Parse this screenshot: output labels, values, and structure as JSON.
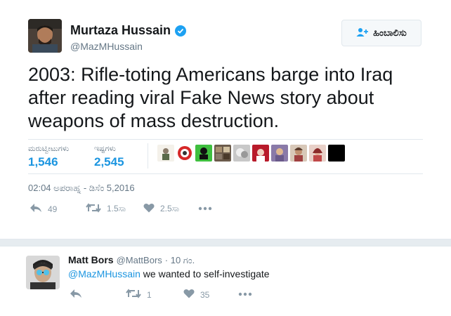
{
  "tweet": {
    "author": {
      "name": "Murtaza Hussain",
      "handle": "@MazMHussain"
    },
    "follow_label": "ಹಿಂಬಾಲಿಸು",
    "text": "2003: Rifle-toting Americans barge into Iraq after reading viral Fake News story about weapons of mass destruction.",
    "stats": {
      "retweets_label": "ಮರುಟ್ವೀಟುಗಳು",
      "retweets_value": "1,546",
      "likes_label": "ಇಷ್ಟಗಳು",
      "likes_value": "2,545"
    },
    "timestamp": "02:04 ಅಪರಾಹ್ನ - ಡಿಸೆಂ 5,2016",
    "actions": {
      "reply_count": "49",
      "retweet_count": "1.5ಸಾ",
      "like_count": "2.5ಸಾ"
    }
  },
  "reply": {
    "name": "Matt Bors",
    "handle": "@MattBors",
    "time": "· 10 ಗಂ.",
    "mention": "@MazMHussain",
    "text": " we wanted to self-investigate",
    "retweet_count": "1",
    "like_count": "35"
  },
  "colors": {
    "accent": "#1b95e0",
    "muted": "#657786",
    "verified": "#1da1f2"
  },
  "icons": [
    "verified-badge-icon",
    "follow-person-icon",
    "reply-icon",
    "retweet-icon",
    "heart-icon",
    "more-icon"
  ]
}
